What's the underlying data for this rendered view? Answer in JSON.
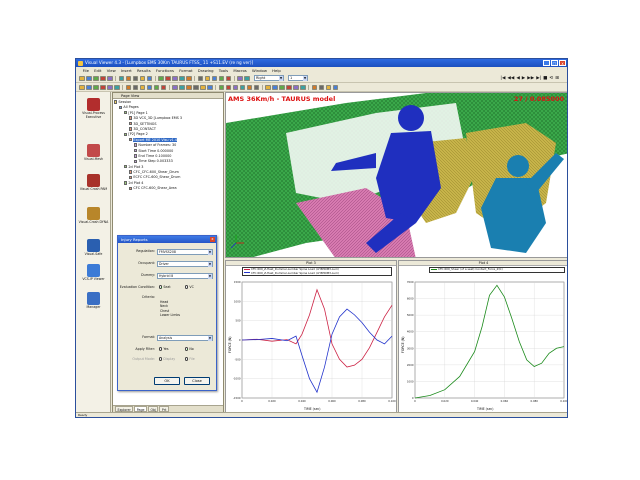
{
  "window": {
    "title": "Visual Viewer 4.3 - [Lumpbox EMS 30Km TAURUS FTSS_ 11 +S11.EV (re ng ver)]",
    "title_icon": "app-icon",
    "buttons": [
      "_",
      "□",
      "x"
    ]
  },
  "menu": [
    "File",
    "Edit",
    "View",
    "Insert",
    "Results",
    "Functions",
    "Format",
    "Drawing",
    "Tools",
    "Macros",
    "Window",
    "Help"
  ],
  "toolbar": {
    "combo1": "Right",
    "combo2": "1",
    "playback_icons": [
      "|◀",
      "◀◀",
      "◀",
      "▶",
      "▶▶",
      "▶|",
      "■",
      "⟲",
      "⊞"
    ]
  },
  "left_panel": {
    "items": [
      {
        "label": "Visual-Process Executive",
        "icon": "executive-icon",
        "color": "#b22d2d"
      },
      {
        "label": "Visual-Mesh",
        "icon": "mesh-icon",
        "color": "#c24a4a"
      },
      {
        "label": "Visual Crash PAM",
        "icon": "crash-icon",
        "color": "#a8322a"
      },
      {
        "label": "Visual-Crash DYNA",
        "icon": "dyna-icon",
        "color": "#b8862a"
      },
      {
        "label": "Visual-Safe",
        "icon": "safe-icon",
        "color": "#2a5fb0"
      },
      {
        "label": "VCS-IP Viewer",
        "icon": "viewer-icon",
        "color": "#3c7bd6"
      },
      {
        "label": "Manager",
        "icon": "manager-icon",
        "color": "#3a6fc4"
      }
    ]
  },
  "page_view": {
    "title": "Page View",
    "tree": [
      {
        "text": "Session",
        "indent": 0,
        "icon": "session-icon"
      },
      {
        "text": "All Pages",
        "indent": 1,
        "icon": "pages-icon"
      },
      {
        "text": "[P1] Page 1",
        "indent": 2,
        "icon": "page-icon"
      },
      {
        "text": "3D VCS_3D [Lumpbox EMS 3",
        "indent": 3,
        "icon": "model-icon"
      },
      {
        "text": "3D_SETTINGS",
        "indent": 3,
        "icon": "settings-icon"
      },
      {
        "text": "3D_CONTACT",
        "indent": 3,
        "icon": "contact-icon"
      },
      {
        "text": "[P2] Page 2",
        "indent": 2,
        "icon": "page-icon"
      },
      {
        "text": "Export ME 2010 Visu v1.4",
        "indent": 3,
        "icon": "export-icon",
        "selected": true
      },
      {
        "text": "Number of Frames: 30",
        "indent": 4,
        "icon": "frames-icon"
      },
      {
        "text": "Start Time   0.000000",
        "indent": 4,
        "icon": "time-icon"
      },
      {
        "text": "End Time   0.100000",
        "indent": 4,
        "icon": "time-icon"
      },
      {
        "text": "Time Step   0.003333",
        "indent": 4,
        "icon": "time-icon"
      },
      {
        "text": "2d Plot 3",
        "indent": 2,
        "icon": "plot-icon"
      },
      {
        "text": "CFC_CFC-600_Shear_Drum",
        "indent": 3,
        "icon": "curve-icon"
      },
      {
        "text": "ECFC CFC-600_Shear_Drum",
        "indent": 3,
        "icon": "curve-icon"
      },
      {
        "text": "2d Plot 4",
        "indent": 2,
        "icon": "plot-icon"
      },
      {
        "text": "CFC CFC-600_Shear_Area",
        "indent": 3,
        "icon": "curve-icon"
      }
    ],
    "tabs": [
      "Explorer",
      "Page",
      "Obj",
      "Prt"
    ]
  },
  "dialog": {
    "title": "Injury Reports",
    "close": "x",
    "rows": [
      {
        "label": "Regulation:",
        "value": "FMVSS208"
      },
      {
        "label": "Occupant:",
        "value": "Driver"
      },
      {
        "label": "Dummy:",
        "value": "Hybrid III"
      }
    ],
    "evaluation": {
      "label": "Evaluation Condition:",
      "opt1": "Seat",
      "opt2": "VC"
    },
    "criteria": {
      "label": "Criteria:",
      "items": [
        "Head",
        "Neck",
        "Chest",
        "Lower Limbs"
      ]
    },
    "format": {
      "label": "Format:",
      "value": "Analysis"
    },
    "filter": {
      "label": "Apply Filter:",
      "opt1": "Yes",
      "opt2": "No"
    },
    "output": {
      "label": "Output Mode:",
      "opt1": "Display",
      "opt2": "File"
    },
    "ok": "OK",
    "close_btn": "Close"
  },
  "viewport": {
    "title": "AMS 36Km/h - TAURUS model",
    "time": "27 / 0.085000"
  },
  "plots": {
    "plot3": {
      "title": "Plot 3",
      "legend": [
        {
          "name": "CFC 600_Z-Hast_Dummer-Lumbar Spine Load (of BPRIM3-Lum)",
          "color": "#cc2244"
        },
        {
          "name": "CFC 600_Z-Hast_Dummer-Lumbar Spine Load (of BPRIM3-Lum)",
          "color": "#2233cc"
        }
      ],
      "ylabel": "FORCE (N)",
      "xlabel": "TIME (sec)"
    },
    "plot4": {
      "title": "Plot 4",
      "legend": [
        {
          "name": "CFC 600_Shear (of a seat) Contact_Force_Z(C)",
          "color": "#1a8a1a"
        }
      ],
      "ylabel": "FORCE (N)",
      "xlabel": "TIME (sec)"
    }
  },
  "chart_data": [
    {
      "type": "line",
      "title": "Plot 3",
      "xlabel": "TIME (sec)",
      "ylabel": "FORCE (N)",
      "xlim": [
        0,
        0.1
      ],
      "ylim": [
        -1500,
        1500
      ],
      "x_ticks": [
        "0",
        "0.020",
        "0.040",
        "0.060",
        "0.080",
        "0.100"
      ],
      "y_ticks": [
        "1500",
        "1000",
        "500",
        "0",
        "-500",
        "-1000",
        "-1500"
      ],
      "series": [
        {
          "name": "CFC 600_Z-Hast_Dummer-Lumbar Spine Load (of BPRIM3-Lum)",
          "color": "#cc2244",
          "x": [
            0,
            0.01,
            0.02,
            0.03,
            0.036,
            0.04,
            0.045,
            0.05,
            0.055,
            0.06,
            0.065,
            0.07,
            0.075,
            0.08,
            0.085,
            0.09,
            0.095,
            0.1
          ],
          "y": [
            0,
            20,
            -30,
            10,
            -100,
            150,
            650,
            1300,
            800,
            -100,
            -500,
            -700,
            -650,
            -500,
            -200,
            200,
            600,
            900
          ]
        },
        {
          "name": "CFC 600_Z-Hast_Dummer-Lumbar Spine Load (of BPRIM3-Lum)",
          "color": "#2233cc",
          "x": [
            0,
            0.01,
            0.02,
            0.03,
            0.036,
            0.04,
            0.045,
            0.05,
            0.055,
            0.06,
            0.065,
            0.07,
            0.075,
            0.08,
            0.085,
            0.09,
            0.095,
            0.1
          ],
          "y": [
            0,
            10,
            40,
            -20,
            100,
            -400,
            -1000,
            -1350,
            -700,
            150,
            600,
            800,
            650,
            450,
            200,
            0,
            -100,
            100
          ]
        }
      ]
    },
    {
      "type": "line",
      "title": "Plot 4",
      "xlabel": "TIME (sec)",
      "ylabel": "FORCE (N)",
      "xlim": [
        0,
        0.1
      ],
      "ylim": [
        0,
        7000
      ],
      "x_ticks": [
        "0",
        "0.020",
        "0.040",
        "0.060",
        "0.080",
        "0.100"
      ],
      "y_ticks": [
        "7000",
        "6000",
        "5000",
        "4000",
        "3000",
        "2000",
        "1000",
        "0"
      ],
      "series": [
        {
          "name": "CFC 600_Shear (of a seat) Contact_Force_Z(C)",
          "color": "#1a8a1a",
          "x": [
            0,
            0.01,
            0.02,
            0.03,
            0.04,
            0.045,
            0.05,
            0.055,
            0.06,
            0.065,
            0.07,
            0.075,
            0.08,
            0.085,
            0.09,
            0.095,
            0.1
          ],
          "y": [
            0,
            150,
            500,
            1300,
            2800,
            4300,
            6200,
            6800,
            6100,
            4800,
            3400,
            2300,
            1900,
            2100,
            2700,
            3000,
            3100
          ]
        }
      ]
    }
  ],
  "statusbar": {
    "text": "Ready"
  }
}
